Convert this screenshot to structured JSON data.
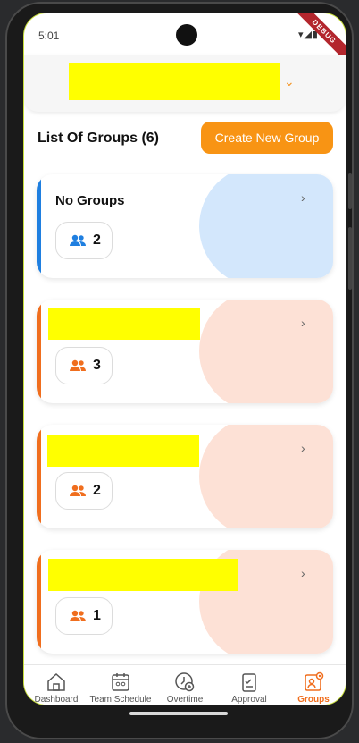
{
  "status_bar": {
    "time": "5:01",
    "debug_label": "DEBUG"
  },
  "colors": {
    "accent": "#f89414",
    "blue": "#1f7fe0",
    "orange": "#f06e1e",
    "blue_blob": "#d3e7fc",
    "orange_blob": "#fde1d6",
    "redaction": "#ffff00"
  },
  "header": {
    "dropdown_icon": "chevron-down-icon"
  },
  "list": {
    "title": "List Of Groups (6)",
    "create_button": "Create New Group"
  },
  "groups": [
    {
      "name": "No Groups",
      "member_count": "2",
      "color": "blue"
    },
    {
      "name": "",
      "member_count": "3",
      "color": "orange"
    },
    {
      "name": "",
      "member_count": "2",
      "color": "orange"
    },
    {
      "name": "",
      "member_count": "1",
      "color": "orange"
    }
  ],
  "nav": {
    "items": [
      {
        "label": "Dashboard",
        "icon": "home-icon"
      },
      {
        "label": "Team Schedule",
        "icon": "calendar-icon"
      },
      {
        "label": "Overtime",
        "icon": "overtime-clock-icon"
      },
      {
        "label": "Approval",
        "icon": "approval-clipboard-icon"
      },
      {
        "label": "Groups",
        "icon": "groups-settings-icon"
      }
    ],
    "active": "Groups"
  }
}
